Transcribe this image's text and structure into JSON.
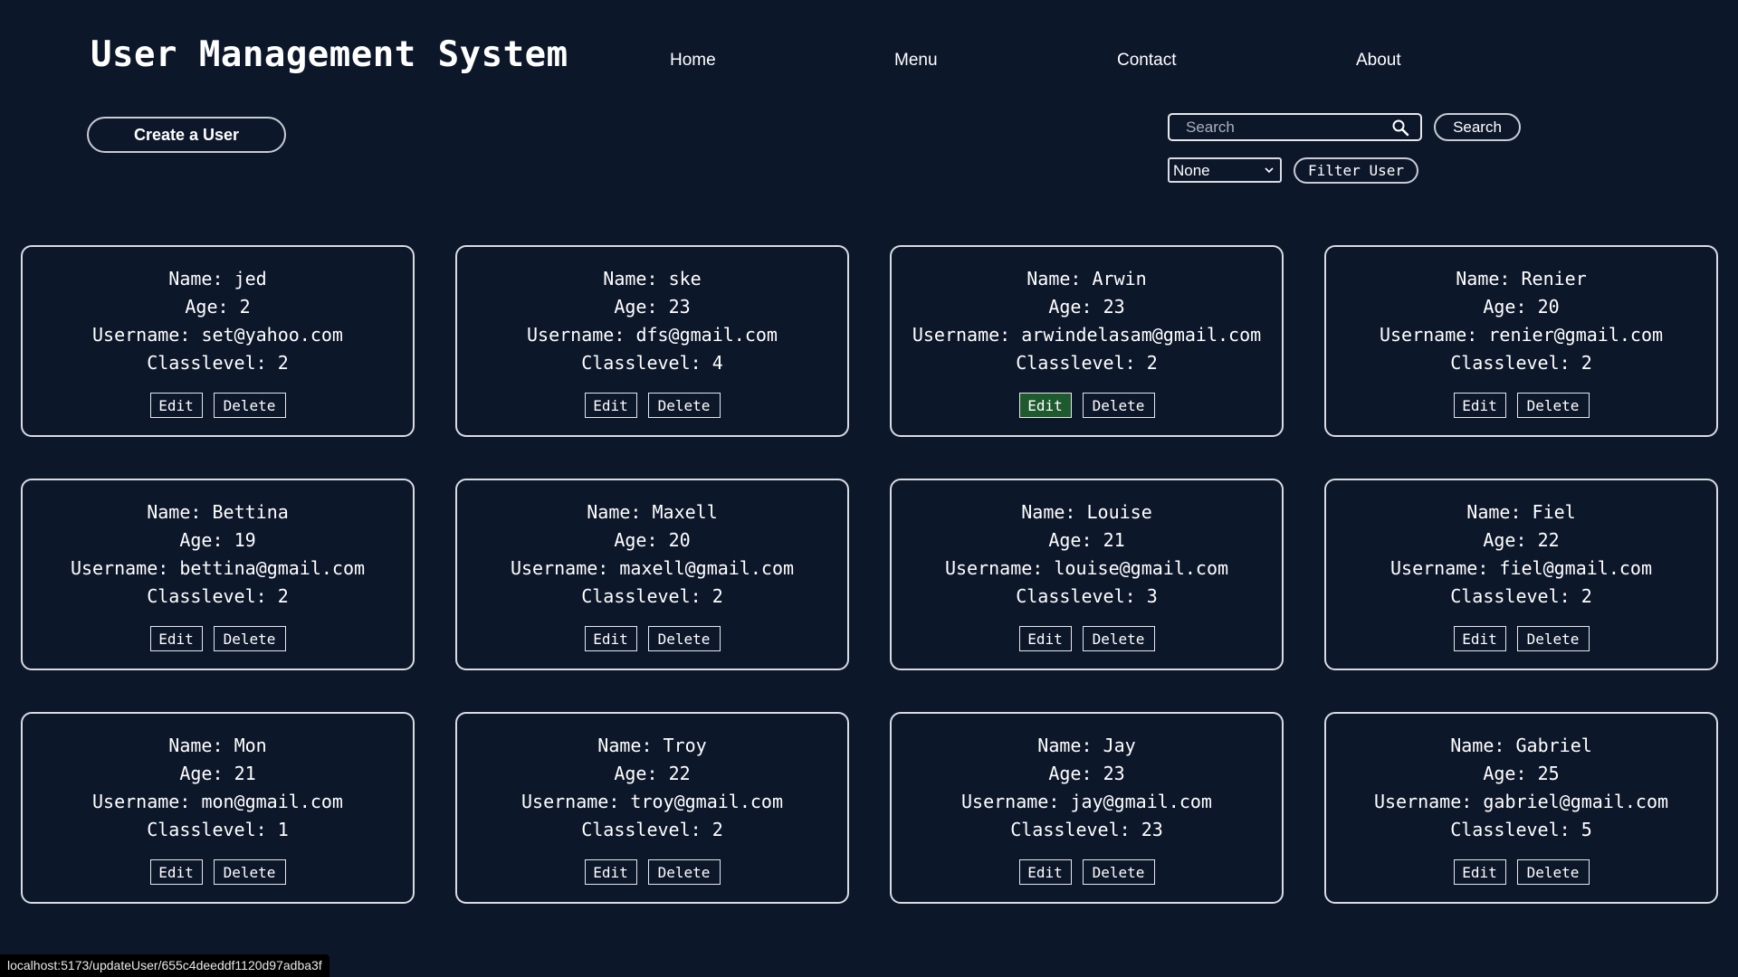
{
  "header": {
    "title": "User Management System",
    "nav": [
      "Home",
      "Menu",
      "Contact",
      "About"
    ]
  },
  "toolbar": {
    "create_label": "Create a User",
    "search_placeholder": "Search",
    "search_button": "Search",
    "filter_selected": "None",
    "filter_button": "Filter User"
  },
  "labels": {
    "name": "Name:",
    "age": "Age:",
    "username": "Username:",
    "classlevel": "Classlevel:",
    "edit": "Edit",
    "delete": "Delete"
  },
  "users": [
    {
      "name": "jed",
      "age": "2",
      "username": "set@yahoo.com",
      "classlevel": "2"
    },
    {
      "name": "ske",
      "age": "23",
      "username": "dfs@gmail.com",
      "classlevel": "4"
    },
    {
      "name": "Arwin",
      "age": "23",
      "username": "arwindelasam@gmail.com",
      "classlevel": "2"
    },
    {
      "name": "Renier",
      "age": "20",
      "username": "renier@gmail.com",
      "classlevel": "2"
    },
    {
      "name": "Bettina",
      "age": "19",
      "username": "bettina@gmail.com",
      "classlevel": "2"
    },
    {
      "name": "Maxell",
      "age": "20",
      "username": "maxell@gmail.com",
      "classlevel": "2"
    },
    {
      "name": "Louise",
      "age": "21",
      "username": "louise@gmail.com",
      "classlevel": "3"
    },
    {
      "name": "Fiel",
      "age": "22",
      "username": "fiel@gmail.com",
      "classlevel": "2"
    },
    {
      "name": "Mon",
      "age": "21",
      "username": "mon@gmail.com",
      "classlevel": "1"
    },
    {
      "name": "Troy",
      "age": "22",
      "username": "troy@gmail.com",
      "classlevel": "2"
    },
    {
      "name": "Jay",
      "age": "23",
      "username": "jay@gmail.com",
      "classlevel": "23"
    },
    {
      "name": "Gabriel",
      "age": "25",
      "username": "gabriel@gmail.com",
      "classlevel": "5"
    }
  ],
  "hovered_edit_index": 2,
  "colors": {
    "background": "#0d172a",
    "edit_hover": "#1e5a2e"
  },
  "statusbar": {
    "url": "localhost:5173/updateUser/655c4deeddf1120d97adba3f"
  }
}
